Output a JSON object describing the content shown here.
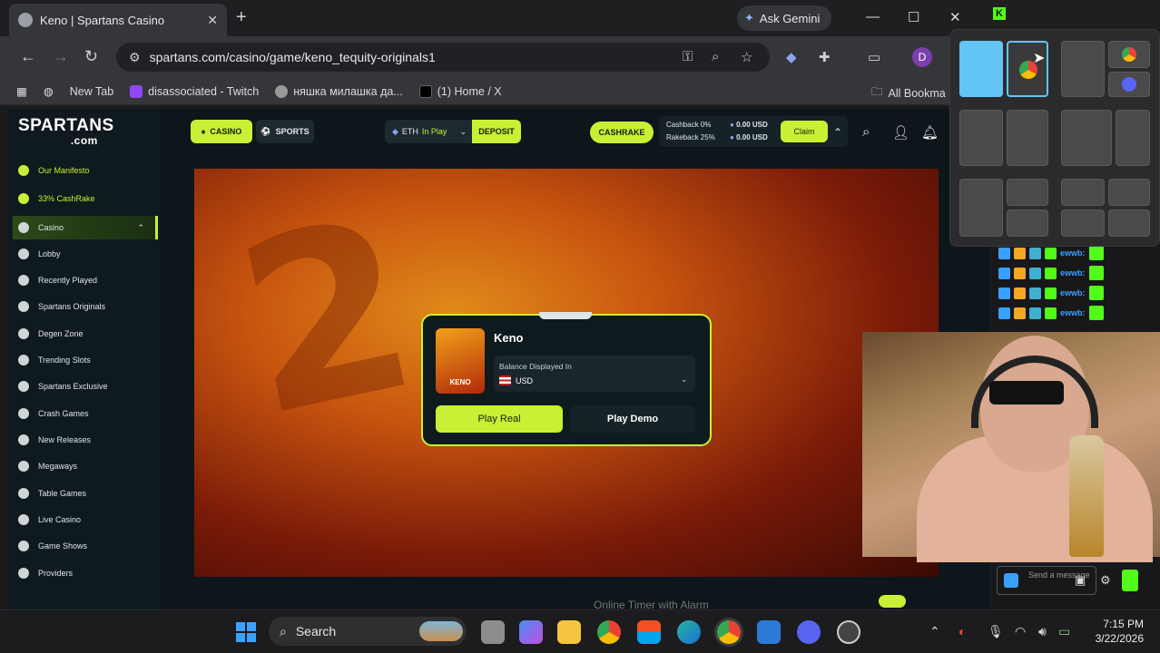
{
  "browser": {
    "tab_title": "Keno | Spartans Casino",
    "tab_close": "✕",
    "new_tab_glyph": "+",
    "gemini_label": "Ask Gemini",
    "url": "spartans.com/casino/game/keno_tequity-originals1",
    "profile_initial": "D",
    "bookmarks": [
      "New Tab",
      "disassociated - Twitch",
      "няшка милашка да...",
      "(1) Home / X"
    ],
    "all_bookmarks": "All Bookma"
  },
  "site": {
    "logo": "SPARTANS",
    "logo_suffix": ".com",
    "nav": {
      "casino": "CASINO",
      "sports": "SPORTS",
      "currency": "ETH",
      "in_play": "In Play",
      "deposit": "DEPOSIT",
      "cashrake": "CASHRAKE",
      "cashback_label": "Cashback 0%",
      "rakeback_label": "Rakeback 25%",
      "cashback_value": "0.00 USD",
      "rakeback_value": "0.00 USD",
      "claim": "Claim"
    },
    "sidebar": [
      {
        "label": "Our Manifesto"
      },
      {
        "label": "33% CashRake"
      },
      {
        "label": "Casino"
      },
      {
        "label": "Lobby"
      },
      {
        "label": "Recently Played"
      },
      {
        "label": "Spartans Originals"
      },
      {
        "label": "Degen Zone"
      },
      {
        "label": "Trending Slots"
      },
      {
        "label": "Spartans Exclusive"
      },
      {
        "label": "Crash Games"
      },
      {
        "label": "New Releases"
      },
      {
        "label": "Megaways"
      },
      {
        "label": "Table Games"
      },
      {
        "label": "Live Casino"
      },
      {
        "label": "Game Shows"
      },
      {
        "label": "Providers"
      }
    ],
    "modal": {
      "game_title": "Keno",
      "thumb_text": "KENO",
      "balance_label": "Balance Displayed In",
      "balance_currency": "USD",
      "play_real": "Play Real",
      "play_demo": "Play Demo"
    },
    "footer_text": "Online Timer with Alarm"
  },
  "chat": {
    "user": "ewwb:",
    "send_placeholder": "Send a message"
  },
  "taskbar": {
    "search_label": "Search",
    "time": "7:15 PM",
    "date": "3/22/2026"
  },
  "colors": {
    "accent": "#c8f035",
    "page_bg": "#0d161a"
  }
}
